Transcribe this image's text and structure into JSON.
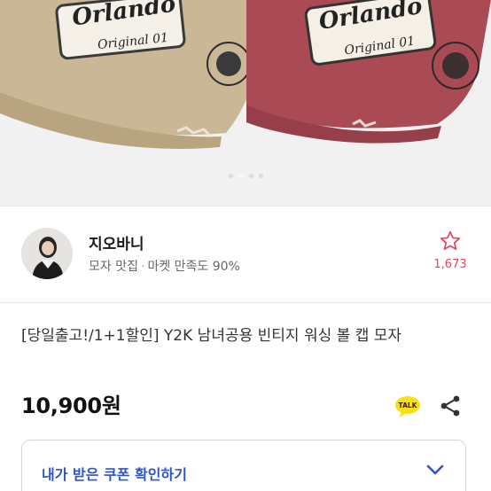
{
  "product_images": {
    "cap_left": {
      "color": "#c7b391",
      "front_text": "Orlando",
      "sub_text": "Original 01"
    },
    "cap_right": {
      "color": "#a84a54",
      "front_text": "Orlando",
      "sub_text": "Original 01"
    },
    "carousel_count": 4,
    "carousel_active": 1
  },
  "seller": {
    "name": "지오바니",
    "category": "모자 맛집",
    "satisfaction": "마켓 만족도 90%",
    "favorites_count": "1,673",
    "favorite_color": "#e0485d"
  },
  "product": {
    "title": "[당일출고!/1+1할인] Y2K 남녀공용 빈티지 워싱 볼 캡 모자",
    "price": "10,900원"
  },
  "actions": {
    "talk_label": "TALK",
    "talk_color": "#f7e015"
  },
  "coupon": {
    "label": "내가 받은 쿠폰 확인하기",
    "accent": "#2e54c8"
  }
}
